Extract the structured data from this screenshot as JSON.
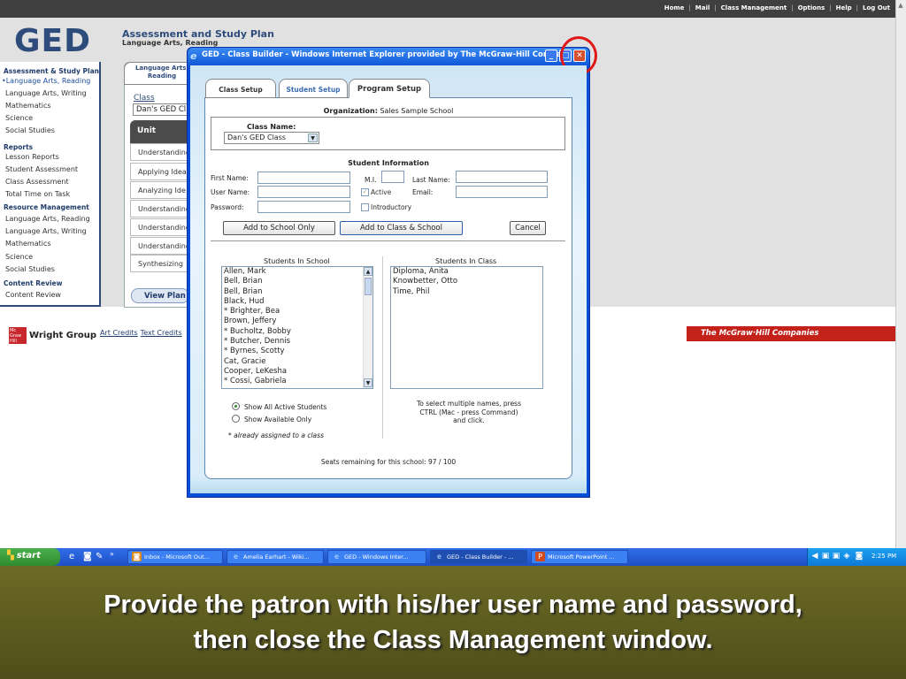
{
  "top_nav": {
    "links": [
      "Home",
      "Mail",
      "Class Management",
      "Options",
      "Help",
      "Log Out"
    ]
  },
  "logo": {
    "text": "GED"
  },
  "header": {
    "title": "Assessment and Study Plan",
    "subtitle": "Language Arts, Reading"
  },
  "left_nav": {
    "section1": "Assessment & Study Plan",
    "items1": [
      "Language Arts, Reading",
      "Language Arts, Writing",
      "Mathematics",
      "Science",
      "Social Studies"
    ],
    "selected_index": 0,
    "section2": "Reports",
    "items2": [
      "Lesson Reports",
      "Student Assessment",
      "Class Assessment",
      "Total Time on Task"
    ],
    "section3": "Resource Management",
    "items3": [
      "Language Arts, Reading",
      "Language Arts, Writing",
      "Mathematics",
      "Science",
      "Social Studies"
    ],
    "section4": "Content Review",
    "items4": [
      "Content Review"
    ]
  },
  "background_card": {
    "tab_label": "Language Arts, Reading",
    "class_label": "Class",
    "class_value": "Dan's GED Cl",
    "unit_header": "Unit",
    "units": [
      "Understanding",
      "Applying Idea",
      "Analyzing Ide",
      "Understanding",
      "Understanding",
      "Understanding",
      "Synthesizing"
    ],
    "view_plan": "View Plan"
  },
  "footer": {
    "wright_group_logo": "Mc Graw Hill",
    "wright_group": "Wright Group",
    "art_credits": "Art Credits",
    "text_credits": "Text Credits",
    "mcgraw_banner": "The McGraw·Hill Companies"
  },
  "popup": {
    "title": "GED - Class Builder - Windows Internet Explorer provided by The McGraw-Hill Compa...",
    "tabs": [
      "Class Setup",
      "Student Setup",
      "Program Setup"
    ],
    "org_label": "Organization:",
    "org_value": "Sales Sample School",
    "class_name_label": "Class Name:",
    "class_name_value": "Dan's GED Class",
    "student_info_heading": "Student Information",
    "fields": {
      "first_name": "First Name:",
      "mi": "M.I.",
      "last_name": "Last Name:",
      "user_name": "User Name:",
      "active": "Active",
      "email": "Email:",
      "password": "Password:",
      "introductory": "Introductory"
    },
    "buttons": {
      "add_school": "Add to School Only",
      "add_class_school": "Add to Class & School",
      "cancel": "Cancel"
    },
    "students_in_school_heading": "Students In School",
    "students_in_school": [
      "Allen, Mark",
      "Bell, Brian",
      "Bell, Brian",
      "Black, Hud",
      "* Brighter, Bea",
      "Brown, Jeffery",
      "* Bucholtz, Bobby",
      "* Butcher, Dennis",
      "* Byrnes, Scotty",
      "Cat, Gracie",
      "Cooper, LeKesha",
      "* Cossi, Gabriela"
    ],
    "students_in_class_heading": "Students In Class",
    "students_in_class": [
      "Diploma, Anita",
      "Knowbetter, Otto",
      "Time, Phil"
    ],
    "radio_all": "Show All Active Students",
    "radio_available": "Show Available Only",
    "assigned_note": "* already assigned to a class",
    "hint": "To select multiple names, press CTRL (Mac - press Command) and click.",
    "seats": "Seats remaining for this school: 97 / 100"
  },
  "taskbar": {
    "start": "start",
    "tasks": [
      "Inbox - Microsoft Out...",
      "Amelia Earhart - Wiki...",
      "GED - Windows Inter...",
      "GED - Class Builder - ...",
      "Microsoft PowerPoint ..."
    ],
    "active_index": 3,
    "time": "2:25 PM"
  },
  "caption": {
    "line1": "Provide the patron with his/her user name and password,",
    "line2": "then close the Class Management window."
  },
  "colors": {
    "brand_blue": "#2e4c7b",
    "xp_blue": "#0b4fd8",
    "close_red": "#d6502d",
    "highlight_circle": "#e01818",
    "mcgraw_red": "#c4211b",
    "caption_bg": "#5e5d20"
  }
}
